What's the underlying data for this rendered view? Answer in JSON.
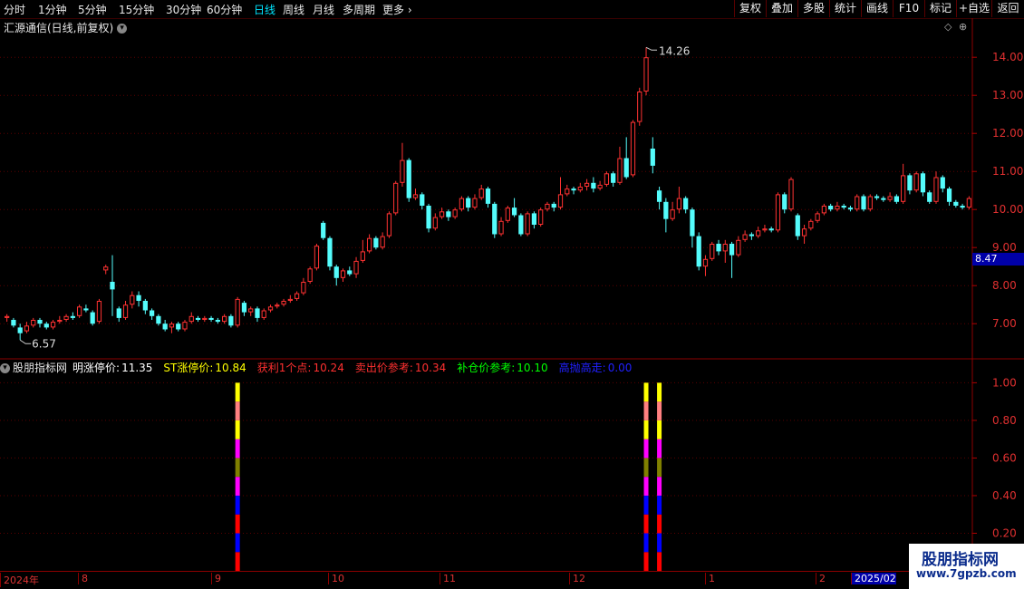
{
  "toolbar": {
    "periods": [
      "分时",
      "1分钟",
      "5分钟",
      "15分钟",
      "30分钟",
      "60分钟",
      "日线",
      "周线",
      "月线",
      "多周期",
      "更多"
    ],
    "active_period": "日线",
    "buttons": [
      "复权",
      "叠加",
      "多股",
      "统计",
      "画线",
      "F10",
      "标记",
      "+自选",
      "返回"
    ]
  },
  "chart_header": {
    "stock": "汇源通信(日线,前复权)"
  },
  "indicator": {
    "name": "股朋指标网",
    "items": [
      {
        "label": "明涨停价:",
        "value": "11.35",
        "color": "#ffffff"
      },
      {
        "label": "ST涨停价:",
        "value": "10.84",
        "color": "#ffff00"
      },
      {
        "label": "获利1个点:",
        "value": "10.24",
        "color": "#ff3030"
      },
      {
        "label": "卖出价参考:",
        "value": "10.34",
        "color": "#ff3030"
      },
      {
        "label": "补仓价参考:",
        "value": "10.10",
        "color": "#00ff00"
      },
      {
        "label": "高抛高走:",
        "value": "0.00",
        "color": "#2020ff"
      }
    ]
  },
  "chart_data": [
    {
      "type": "candlestick",
      "title": "汇源通信(日线,前复权)",
      "y_ticks": [
        "7.00",
        "8.00",
        "9.00",
        "10.00",
        "11.00",
        "12.00",
        "13.00",
        "14.00"
      ],
      "ylim": [
        6.1,
        14.6
      ],
      "high_label": "14.26",
      "low_label": "6.57",
      "last_price": "8.47",
      "colors": {
        "up": "#ff3232",
        "down": "#54fcfc"
      },
      "candles": [
        [
          7.15,
          7.2,
          7.05,
          7.25
        ],
        [
          7.1,
          6.95,
          6.9,
          7.15
        ],
        [
          6.9,
          6.75,
          6.57,
          7.0
        ],
        [
          6.8,
          6.95,
          6.75,
          7.05
        ],
        [
          6.95,
          7.1,
          6.9,
          7.15
        ],
        [
          7.1,
          7.0,
          6.9,
          7.15
        ],
        [
          7.0,
          6.9,
          6.85,
          7.05
        ],
        [
          6.9,
          7.05,
          6.85,
          7.1
        ],
        [
          7.05,
          7.1,
          7.0,
          7.2
        ],
        [
          7.1,
          7.2,
          7.05,
          7.25
        ],
        [
          7.2,
          7.15,
          7.1,
          7.3
        ],
        [
          7.2,
          7.45,
          7.15,
          7.5
        ],
        [
          7.4,
          7.35,
          7.3,
          7.5
        ],
        [
          7.3,
          7.0,
          6.95,
          7.35
        ],
        [
          7.05,
          7.6,
          7.0,
          7.65
        ],
        [
          8.4,
          8.5,
          8.3,
          8.55
        ],
        [
          8.1,
          7.9,
          7.2,
          8.8
        ],
        [
          7.4,
          7.15,
          7.05,
          7.45
        ],
        [
          7.15,
          7.5,
          7.1,
          7.6
        ],
        [
          7.5,
          7.75,
          7.4,
          7.85
        ],
        [
          7.75,
          7.6,
          7.45,
          7.85
        ],
        [
          7.6,
          7.35,
          7.25,
          7.65
        ],
        [
          7.35,
          7.2,
          7.1,
          7.4
        ],
        [
          7.2,
          7.0,
          6.95,
          7.25
        ],
        [
          7.0,
          6.85,
          6.8,
          7.1
        ],
        [
          6.9,
          7.0,
          6.75,
          7.05
        ],
        [
          7.0,
          6.85,
          6.8,
          7.05
        ],
        [
          6.85,
          7.05,
          6.8,
          7.1
        ],
        [
          7.05,
          7.2,
          7.0,
          7.3
        ],
        [
          7.15,
          7.1,
          7.05,
          7.2
        ],
        [
          7.1,
          7.15,
          7.05,
          7.2
        ],
        [
          7.15,
          7.1,
          7.05,
          7.2
        ],
        [
          7.1,
          7.05,
          7.0,
          7.15
        ],
        [
          7.05,
          7.2,
          7.0,
          7.25
        ],
        [
          7.2,
          6.95,
          6.9,
          7.25
        ],
        [
          6.95,
          7.65,
          6.9,
          7.7
        ],
        [
          7.55,
          7.3,
          7.2,
          7.6
        ],
        [
          7.3,
          7.4,
          7.2,
          7.45
        ],
        [
          7.4,
          7.15,
          7.05,
          7.45
        ],
        [
          7.15,
          7.35,
          7.1,
          7.4
        ],
        [
          7.35,
          7.45,
          7.3,
          7.5
        ],
        [
          7.45,
          7.5,
          7.4,
          7.55
        ],
        [
          7.5,
          7.6,
          7.45,
          7.65
        ],
        [
          7.6,
          7.65,
          7.55,
          7.75
        ],
        [
          7.65,
          7.8,
          7.6,
          7.85
        ],
        [
          7.8,
          8.1,
          7.75,
          8.2
        ],
        [
          8.1,
          8.45,
          8.05,
          8.5
        ],
        [
          8.45,
          9.05,
          8.4,
          9.1
        ],
        [
          9.65,
          9.25,
          9.2,
          9.7
        ],
        [
          9.25,
          8.5,
          8.4,
          9.3
        ],
        [
          8.5,
          8.2,
          8.0,
          8.55
        ],
        [
          8.2,
          8.4,
          8.1,
          8.45
        ],
        [
          8.4,
          8.3,
          8.25,
          8.5
        ],
        [
          8.3,
          8.65,
          8.2,
          8.75
        ],
        [
          8.65,
          8.9,
          8.6,
          9.2
        ],
        [
          8.9,
          9.25,
          8.85,
          9.35
        ],
        [
          9.25,
          9.0,
          8.95,
          9.3
        ],
        [
          9.0,
          9.3,
          8.95,
          9.4
        ],
        [
          9.3,
          9.9,
          9.25,
          9.95
        ],
        [
          9.9,
          10.7,
          9.85,
          10.75
        ],
        [
          10.7,
          11.3,
          10.6,
          11.75
        ],
        [
          11.3,
          10.3,
          10.2,
          11.35
        ],
        [
          10.3,
          10.4,
          10.25,
          10.55
        ],
        [
          10.4,
          10.1,
          10.0,
          10.45
        ],
        [
          10.1,
          9.5,
          9.4,
          10.15
        ],
        [
          9.5,
          9.8,
          9.45,
          9.9
        ],
        [
          9.8,
          9.95,
          9.75,
          10.05
        ],
        [
          9.95,
          9.8,
          9.7,
          10.0
        ],
        [
          9.8,
          10.0,
          9.75,
          10.05
        ],
        [
          10.0,
          10.3,
          9.95,
          10.35
        ],
        [
          10.3,
          10.05,
          9.95,
          10.35
        ],
        [
          10.05,
          10.3,
          10.0,
          10.4
        ],
        [
          10.3,
          10.55,
          10.25,
          10.65
        ],
        [
          10.55,
          10.15,
          10.05,
          10.6
        ],
        [
          10.15,
          9.35,
          9.25,
          10.2
        ],
        [
          9.35,
          9.7,
          9.3,
          9.8
        ],
        [
          9.7,
          10.05,
          9.65,
          10.1
        ],
        [
          10.05,
          9.85,
          9.8,
          10.3
        ],
        [
          9.85,
          9.35,
          9.3,
          9.9
        ],
        [
          9.35,
          9.9,
          9.3,
          9.95
        ],
        [
          9.9,
          9.6,
          9.5,
          9.95
        ],
        [
          9.6,
          10.0,
          9.55,
          10.05
        ],
        [
          10.0,
          10.15,
          9.95,
          10.2
        ],
        [
          10.15,
          10.05,
          9.95,
          10.2
        ],
        [
          10.05,
          10.4,
          10.0,
          10.85
        ],
        [
          10.4,
          10.55,
          10.35,
          10.65
        ],
        [
          10.55,
          10.5,
          10.4,
          10.6
        ],
        [
          10.5,
          10.6,
          10.45,
          10.7
        ],
        [
          10.6,
          10.7,
          10.5,
          10.8
        ],
        [
          10.7,
          10.55,
          10.45,
          10.85
        ],
        [
          10.55,
          10.65,
          10.5,
          10.75
        ],
        [
          10.65,
          10.95,
          10.6,
          11.0
        ],
        [
          10.95,
          10.7,
          10.6,
          11.0
        ],
        [
          10.7,
          11.35,
          10.65,
          11.65
        ],
        [
          11.35,
          10.85,
          10.8,
          11.9
        ],
        [
          10.9,
          12.3,
          10.85,
          12.35
        ],
        [
          12.3,
          13.1,
          12.2,
          13.2
        ],
        [
          13.1,
          14.0,
          13.0,
          14.26
        ],
        [
          11.6,
          11.15,
          10.95,
          11.9
        ],
        [
          10.5,
          10.2,
          10.0,
          10.6
        ],
        [
          10.2,
          9.75,
          9.4,
          10.3
        ],
        [
          9.75,
          10.0,
          9.7,
          10.2
        ],
        [
          10.0,
          10.3,
          9.9,
          10.6
        ],
        [
          10.3,
          10.0,
          9.9,
          10.35
        ],
        [
          10.0,
          9.3,
          9.0,
          10.05
        ],
        [
          9.3,
          8.5,
          8.4,
          9.4
        ],
        [
          8.5,
          8.7,
          8.25,
          8.8
        ],
        [
          8.7,
          9.1,
          8.65,
          9.15
        ],
        [
          9.1,
          8.9,
          8.8,
          9.2
        ],
        [
          8.9,
          9.1,
          8.6,
          9.2
        ],
        [
          9.1,
          8.8,
          8.2,
          9.15
        ],
        [
          8.8,
          9.2,
          8.75,
          9.3
        ],
        [
          9.2,
          9.35,
          9.15,
          9.45
        ],
        [
          9.35,
          9.3,
          9.2,
          9.4
        ],
        [
          9.3,
          9.45,
          9.25,
          9.55
        ],
        [
          9.45,
          9.5,
          9.4,
          9.6
        ],
        [
          9.5,
          9.45,
          9.4,
          9.55
        ],
        [
          9.45,
          10.4,
          9.4,
          10.45
        ],
        [
          10.4,
          10.0,
          9.9,
          10.45
        ],
        [
          10.0,
          10.8,
          9.95,
          10.85
        ],
        [
          9.85,
          9.3,
          9.2,
          9.9
        ],
        [
          9.3,
          9.5,
          9.1,
          9.6
        ],
        [
          9.5,
          9.7,
          9.45,
          9.75
        ],
        [
          9.7,
          9.9,
          9.65,
          9.95
        ],
        [
          9.9,
          10.1,
          9.85,
          10.15
        ],
        [
          10.1,
          10.0,
          9.95,
          10.15
        ],
        [
          10.0,
          10.1,
          9.95,
          10.2
        ],
        [
          10.1,
          10.05,
          10.0,
          10.15
        ],
        [
          10.05,
          10.0,
          9.95,
          10.1
        ],
        [
          10.0,
          10.35,
          9.95,
          10.4
        ],
        [
          10.35,
          10.0,
          9.95,
          10.4
        ],
        [
          10.0,
          10.35,
          9.95,
          10.4
        ],
        [
          10.35,
          10.3,
          10.25,
          10.4
        ],
        [
          10.3,
          10.25,
          10.2,
          10.35
        ],
        [
          10.25,
          10.35,
          10.2,
          10.45
        ],
        [
          10.35,
          10.2,
          10.15,
          10.4
        ],
        [
          10.2,
          10.9,
          10.15,
          11.2
        ],
        [
          10.9,
          10.5,
          10.4,
          10.95
        ],
        [
          10.5,
          10.95,
          10.45,
          11.0
        ],
        [
          10.95,
          10.45,
          10.35,
          11.0
        ],
        [
          10.45,
          10.2,
          10.15,
          10.5
        ],
        [
          10.2,
          10.85,
          10.15,
          11.0
        ],
        [
          10.85,
          10.55,
          10.45,
          10.9
        ],
        [
          10.55,
          10.2,
          10.1,
          10.6
        ],
        [
          10.2,
          10.1,
          10.05,
          10.25
        ],
        [
          10.1,
          10.05,
          10.0,
          10.15
        ],
        [
          10.05,
          10.3,
          10.0,
          10.35
        ]
      ]
    },
    {
      "type": "stacked-bar",
      "name": "股朋指标网",
      "y_ticks": [
        "0.20",
        "0.40",
        "0.60",
        "0.80",
        "1.00"
      ],
      "ylim": [
        0,
        1.05
      ],
      "bars": [
        {
          "candle_index": 35,
          "segments": [
            "#ff0000",
            "#0000ff",
            "#ff0000",
            "#0000ff",
            "#ff00ff",
            "#808000",
            "#ff00ff",
            "#ffff00",
            "#ff8080",
            "#ffff00"
          ]
        },
        {
          "candle_index": 97,
          "segments": [
            "#ff0000",
            "#0000ff",
            "#ff0000",
            "#0000ff",
            "#ff00ff",
            "#808000",
            "#ff00ff",
            "#ffff00",
            "#ff8080",
            "#ffff00"
          ]
        },
        {
          "candle_index": 99,
          "segments": [
            "#ff0000",
            "#0000ff",
            "#ff0000",
            "#0000ff",
            "#ff00ff",
            "#808000",
            "#ff00ff",
            "#ffff00",
            "#ff8080",
            "#ffff00"
          ]
        }
      ]
    }
  ],
  "date_axis": [
    {
      "label": "2024年",
      "selected": false
    },
    {
      "label": "8",
      "selected": false
    },
    {
      "label": "9",
      "selected": false
    },
    {
      "label": "10",
      "selected": false
    },
    {
      "label": "11",
      "selected": false
    },
    {
      "label": "12",
      "selected": false
    },
    {
      "label": "1",
      "selected": false
    },
    {
      "label": "2",
      "selected": false
    },
    {
      "label": "2025/02",
      "selected": true
    }
  ],
  "watermark": {
    "title": "股朋指标网",
    "url": "www.7gpzb.com"
  }
}
